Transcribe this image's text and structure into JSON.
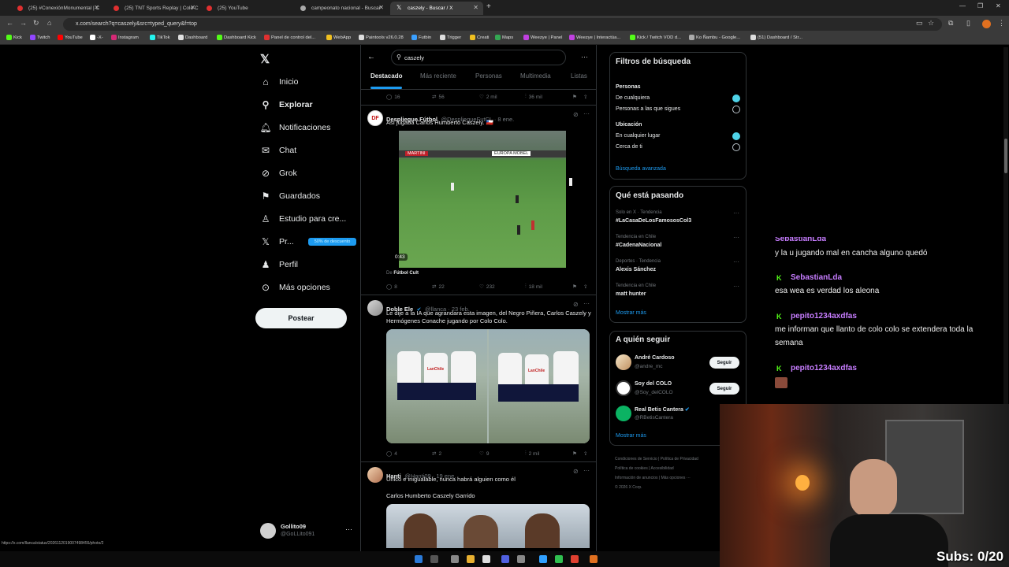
{
  "browser": {
    "tabs": [
      {
        "title": "(25) #ConexiónMonumental | C",
        "fav": "#e03030"
      },
      {
        "title": "(25) TNT Sports Replay | Colo C",
        "fav": "#e03030"
      },
      {
        "title": "(25) YouTube",
        "fav": "#e03030"
      },
      {
        "title": "campeonato nacional - Buscar",
        "fav": "#aaaaaa"
      },
      {
        "title": "caszely - Buscar / X",
        "fav": "#ffffff"
      }
    ],
    "url": "x.com/search?q=caszely&src=typed_query&f=top",
    "status_url": "https://x.com/llanca/status/2026112019007498455/photo/2",
    "bookmarks": [
      "Kick",
      "Twitch",
      "YouTube",
      "-X-",
      "Instagram",
      "TikTok",
      "Dashboard",
      "Dashboard Kick",
      "Panel de control del...",
      "WebApp",
      "Paintools v26.0.28",
      "Futbin",
      "Trigger",
      "Creati",
      "Maps",
      "Weezye | Panel",
      "Weezye | Interactúa...",
      "Kick / Twitch VOD d...",
      "Ko Ñambu - Google...",
      "(51) Dashboard / Str..."
    ]
  },
  "nav": {
    "items": [
      {
        "label": "Inicio",
        "icon": "home-icon"
      },
      {
        "label": "Explorar",
        "icon": "search-icon"
      },
      {
        "label": "Notificaciones",
        "icon": "bell-icon"
      },
      {
        "label": "Chat",
        "icon": "mail-icon"
      },
      {
        "label": "Grok",
        "icon": "grok-icon"
      },
      {
        "label": "Guardados",
        "icon": "bookmark-icon"
      },
      {
        "label": "Estudio para cre...",
        "icon": "studio-icon"
      },
      {
        "label": "Pr...",
        "icon": "x-logo-icon"
      },
      {
        "label": "Perfil",
        "icon": "person-icon"
      },
      {
        "label": "Más opciones",
        "icon": "more-icon"
      }
    ],
    "premium_badge": "50% de descuento",
    "post_label": "Postear",
    "account": {
      "name": "Gollito09",
      "handle": "@GoLLito091"
    }
  },
  "search": {
    "query": "caszely",
    "tabs": [
      "Destacado",
      "Más reciente",
      "Personas",
      "Multimedia",
      "Listas"
    ]
  },
  "tweets": [
    {
      "actions": {
        "replies": "16",
        "reposts": "56",
        "likes": "2 mil",
        "views": "36 mil"
      }
    },
    {
      "name": "Despliegue Fútbol",
      "handle": "@DespliegueFutCL · 8 ene.",
      "text": "Así jugaba Carlos Humberto Caszely. 🇨🇱",
      "video_duration": "0:43",
      "video_boards": [
        "MARTINI",
        "EUROPA MOBEL"
      ],
      "source_label": "De",
      "source": "Fútbol Cult",
      "actions": {
        "replies": "8",
        "reposts": "22",
        "likes": "232",
        "views": "18 mil"
      }
    },
    {
      "name": "Doble Ele",
      "handle": "@llanca · 23 feb.",
      "text": "Le dije a la IA que agrandara esta imagen, del Negro Piñera, Carlos Caszely y Hermógenes Conache jugando por Colo Colo.",
      "shirt_text": "LanChile",
      "actions": {
        "replies": "4",
        "reposts": "2",
        "likes": "9",
        "views": "2 mil"
      }
    },
    {
      "name": "Hanti",
      "handle": "@Hanti09 · 19 ene.",
      "text": "Único e inigualable, nunca habrá alguien como él",
      "text2": "Carlos Humberto Caszely Garrido"
    }
  ],
  "filters": {
    "title": "Filtros de búsqueda",
    "people_title": "Personas",
    "people_options": [
      "De cualquiera",
      "Personas a las que sigues"
    ],
    "location_title": "Ubicación",
    "location_options": [
      "En cualquier lugar",
      "Cerca de ti"
    ],
    "advanced": "Búsqueda avanzada"
  },
  "trends": {
    "title": "Qué está pasando",
    "items": [
      {
        "context": "Solo en X · Tendencia",
        "name": "#LaCasaDeLosFamososCol3"
      },
      {
        "context": "Tendencia en Chile",
        "name": "#CadenaNacional"
      },
      {
        "context": "Deportes · Tendencia",
        "name": "Alexis Sánchez"
      },
      {
        "context": "Tendencia en Chile",
        "name": "matt hunter"
      }
    ],
    "more": "Mostrar más"
  },
  "who_to_follow": {
    "title": "A quién seguir",
    "items": [
      {
        "name": "André Cardoso",
        "handle": "@andre_mc"
      },
      {
        "name": "Soy del COLO",
        "handle": "@Soy_delCOLO"
      },
      {
        "name": "Real Betis Cantera",
        "handle": "@RBetisCantera"
      }
    ],
    "follow_label": "Seguir",
    "more": "Mostrar más"
  },
  "footer_links": [
    "Condiciones de Servicio",
    "Política de Privacidad",
    "Política de cookies",
    "Accesibilidad",
    "Información de anuncios",
    "Más opciones ···",
    "© 2026 X Corp."
  ],
  "chat": {
    "messages": [
      {
        "user": "SebastianLda",
        "text": "y la u jugando mal en cancha alguno quedó"
      },
      {
        "user": "SebastianLda",
        "text": "esa wea es verdad los aleona"
      },
      {
        "user": "pepito1234axdfas",
        "text": "me informan que llanto de colo colo se extendera toda la semana"
      },
      {
        "user": "pepito1234axdfas",
        "text": ""
      }
    ]
  },
  "overlay": {
    "subs": "Subs: 0/20"
  }
}
